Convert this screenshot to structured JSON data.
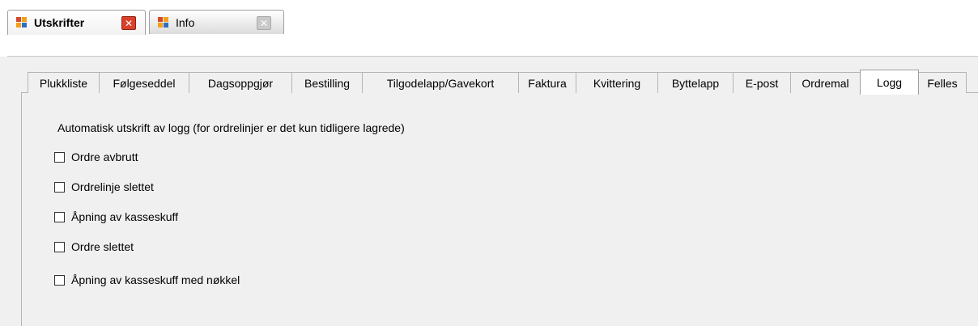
{
  "document_tabs": [
    {
      "label": "Utskrifter",
      "active": true,
      "icon": "app-icon",
      "close_icon": "close-icon-red"
    },
    {
      "label": "Info",
      "active": false,
      "icon": "app-icon",
      "close_icon": "close-icon-gray"
    }
  ],
  "settings_tabs": [
    "Plukkliste",
    "Følgeseddel",
    "Dagsoppgjør",
    "Bestilling",
    "Tilgodelapp/Gavekort",
    "Faktura",
    "Kvittering",
    "Byttelapp",
    "E-post",
    "Ordremal",
    "Logg",
    "Felles"
  ],
  "active_settings_tab": "Logg",
  "logg_panel": {
    "heading": "Automatisk utskrift av logg (for ordrelinjer er det kun tidligere lagrede)",
    "options": [
      {
        "label": "Ordre avbrutt",
        "checked": false
      },
      {
        "label": "Ordrelinje slettet",
        "checked": false
      },
      {
        "label": "Åpning av kasseskuff",
        "checked": false
      },
      {
        "label": "Ordre slettet",
        "checked": false
      },
      {
        "label": "Åpning av kasseskuff med nøkkel",
        "checked": false
      }
    ]
  },
  "colors": {
    "close_active": "#d9412a",
    "close_inactive": "#c9c9c9",
    "window_bg": "#f0f0f0"
  }
}
